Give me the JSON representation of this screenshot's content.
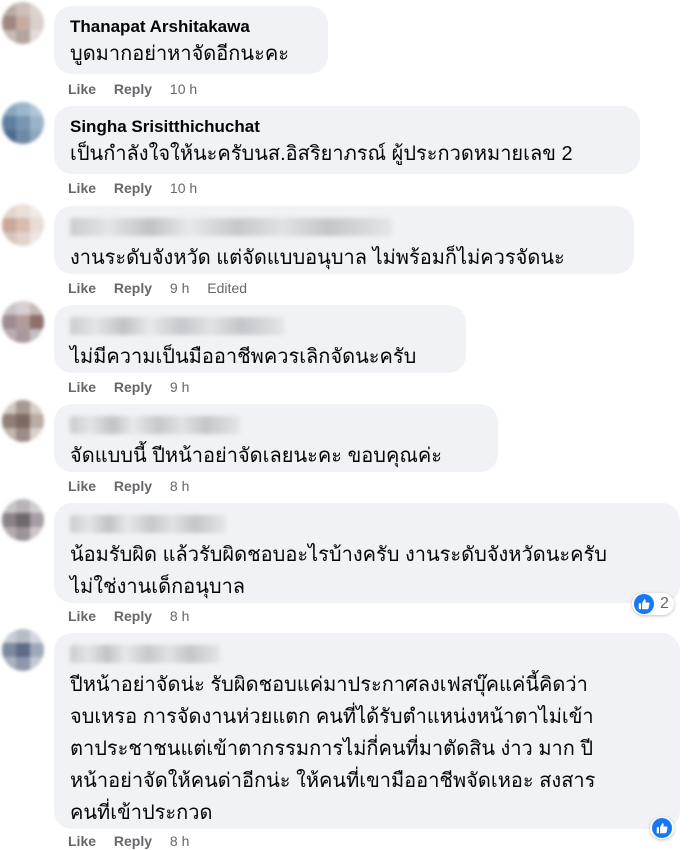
{
  "comments": [
    {
      "author": "Thanapat Arshitakawa",
      "text": [
        "บูดมากอย่าหาจัดอีกนะคะ"
      ],
      "like": "Like",
      "reply": "Reply",
      "time": "10 h"
    },
    {
      "author": "Singha Srisitthichuchat",
      "text": [
        "เป็นกำลังใจให้นะครับนส.อิสริยาภรณ์ ผู้ประกวดหมายเลข 2"
      ],
      "like": "Like",
      "reply": "Reply",
      "time": "10 h"
    },
    {
      "author": "",
      "text": [
        "งานระดับจังหวัด แต่จัดแบบอนุบาล ไม่พร้อมก็ไม่ควรจัดนะ"
      ],
      "like": "Like",
      "reply": "Reply",
      "time": "9 h",
      "edited": "Edited"
    },
    {
      "author": "",
      "text": [
        "ไม่มีความเป็นมืออาชีพควรเลิกจัดนะครับ"
      ],
      "like": "Like",
      "reply": "Reply",
      "time": "9 h"
    },
    {
      "author": "",
      "text": [
        "จัดแบบนี้ ปีหน้าอย่าจัดเลยนะคะ ขอบคุณค่ะ"
      ],
      "like": "Like",
      "reply": "Reply",
      "time": "8 h"
    },
    {
      "author": "",
      "text": [
        "น้อมรับผิด แล้วรับผิดชอบอะไรบ้างครับ งานระดับจังหวัดนะครับ",
        "ไม่ใช่งานเด็กอนุบาล"
      ],
      "like": "Like",
      "reply": "Reply",
      "time": "8 h",
      "reaction_count": "2"
    },
    {
      "author": "",
      "text": [
        "ปีหน้าอย่าจัดน่ะ รับผิดชอบแค่มาประกาศลงเฟสบุ๊คแค่นี้คิดว่า",
        "จบเหรอ การจัดงานห่วยแตก คนที่ได้รับตำแหน่งหน้าตาไม่เข้า",
        "ตาประชาชนแต่เข้าตากรรมการไม่กี่คนที่มาตัดสิน ง่าว มาก ปี",
        "หน้าอย่าจัดให้คนด่าอีกน่ะ ให้คนที่เขามืออาชีพจัดเหอะ สงสาร",
        "คนที่เข้าประกวด"
      ],
      "like": "Like",
      "reply": "Reply",
      "time": "8 h",
      "reaction_count": ""
    }
  ],
  "colors": {
    "bubble": "#f0f2f5",
    "meta": "#65676b",
    "like_blue": "#1877f2"
  },
  "icons": {
    "reaction": "thumbs-up-icon"
  }
}
